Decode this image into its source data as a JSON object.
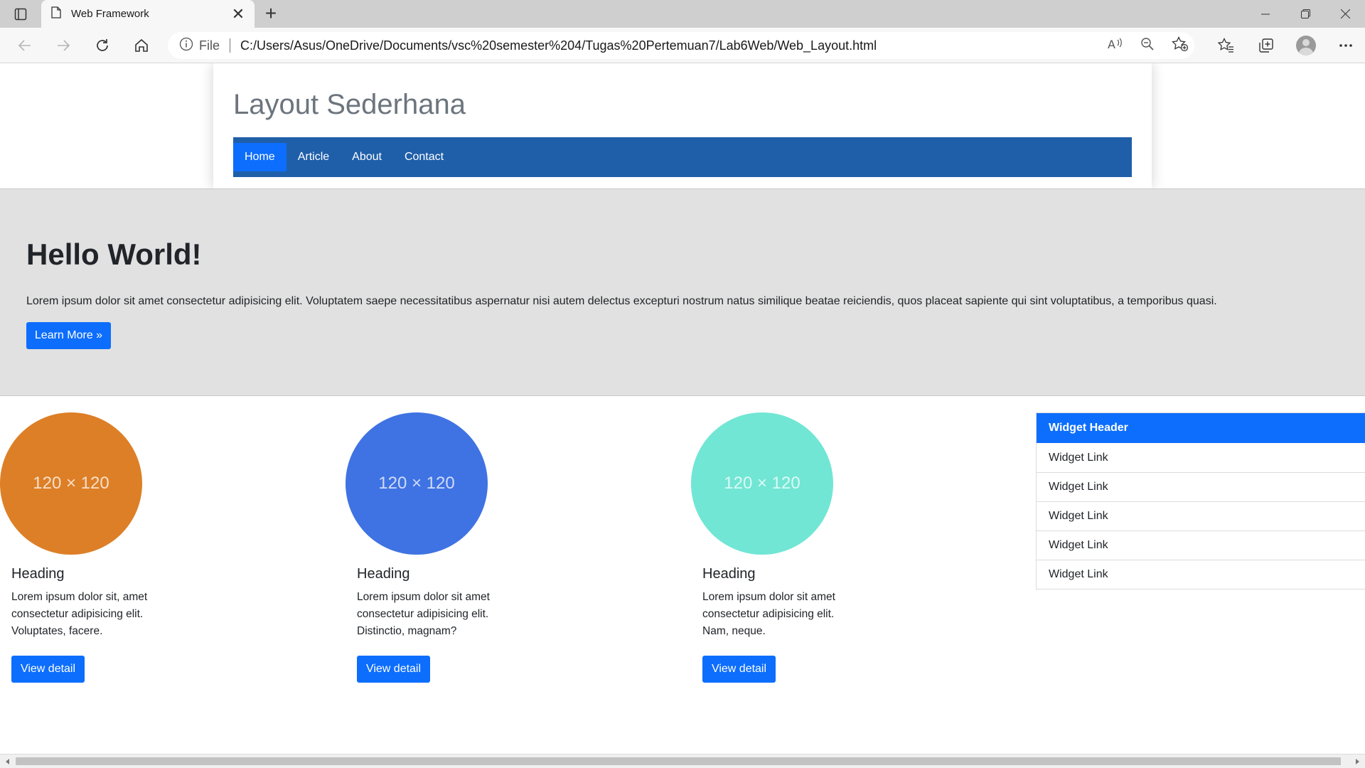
{
  "browser": {
    "tab_title": "Web Framework",
    "new_tab_symbol": "+",
    "close_tab_symbol": "✕",
    "url_scheme_label": "File",
    "url": "C:/Users/Asus/OneDrive/Documents/vsc%20semester%204/Tugas%20Pertemuan7/Lab6Web/Web_Layout.html",
    "icons": [
      "tab-actions-icon",
      "page-icon",
      "back-arrow-icon",
      "forward-arrow-icon",
      "refresh-icon",
      "home-icon",
      "info-icon",
      "read-aloud-icon",
      "zoom-out-icon",
      "add-favorite-icon",
      "favorites-icon",
      "collections-icon",
      "profile-avatar",
      "more-menu-icon",
      "minimize-icon",
      "restore-icon",
      "close-window-icon"
    ]
  },
  "site": {
    "title": "Layout Sederhana",
    "nav": [
      {
        "label": "Home",
        "active": true
      },
      {
        "label": "Article",
        "active": false
      },
      {
        "label": "About",
        "active": false
      },
      {
        "label": "Contact",
        "active": false
      }
    ]
  },
  "hero": {
    "title": "Hello World!",
    "text": "Lorem ipsum dolor sit amet consectetur adipisicing elit. Voluptatem saepe necessitatibus aspernatur nisi autem delectus excepturi nostrum natus similique beatae reiciendis, quos placeat sapiente qui sint voluptatibus, a temporibus quasi.",
    "button_label": "Learn More »"
  },
  "cards": [
    {
      "image_label": "120 × 120",
      "color": "#dd7f26",
      "heading": "Heading",
      "text": "Lorem ipsum dolor sit, amet consectetur adipisicing elit. Voluptates, facere.",
      "button_label": "View detail"
    },
    {
      "image_label": "120 × 120",
      "color": "#3f72e2",
      "heading": "Heading",
      "text": "Lorem ipsum dolor sit amet consectetur adipisicing elit. Distinctio, magnam?",
      "button_label": "View detail"
    },
    {
      "image_label": "120 × 120",
      "color": "#72e6d5",
      "heading": "Heading",
      "text": "Lorem ipsum dolor sit amet consectetur adipisicing elit. Nam, neque.",
      "button_label": "View detail"
    }
  ],
  "widget": {
    "header": "Widget Header",
    "links": [
      "Widget Link",
      "Widget Link",
      "Widget Link",
      "Widget Link",
      "Widget Link"
    ]
  },
  "colors": {
    "nav_bar": "#1f5faa",
    "primary": "#0d6efd",
    "hero_bg": "#e1e1e1",
    "title_gray": "#6c757d"
  }
}
